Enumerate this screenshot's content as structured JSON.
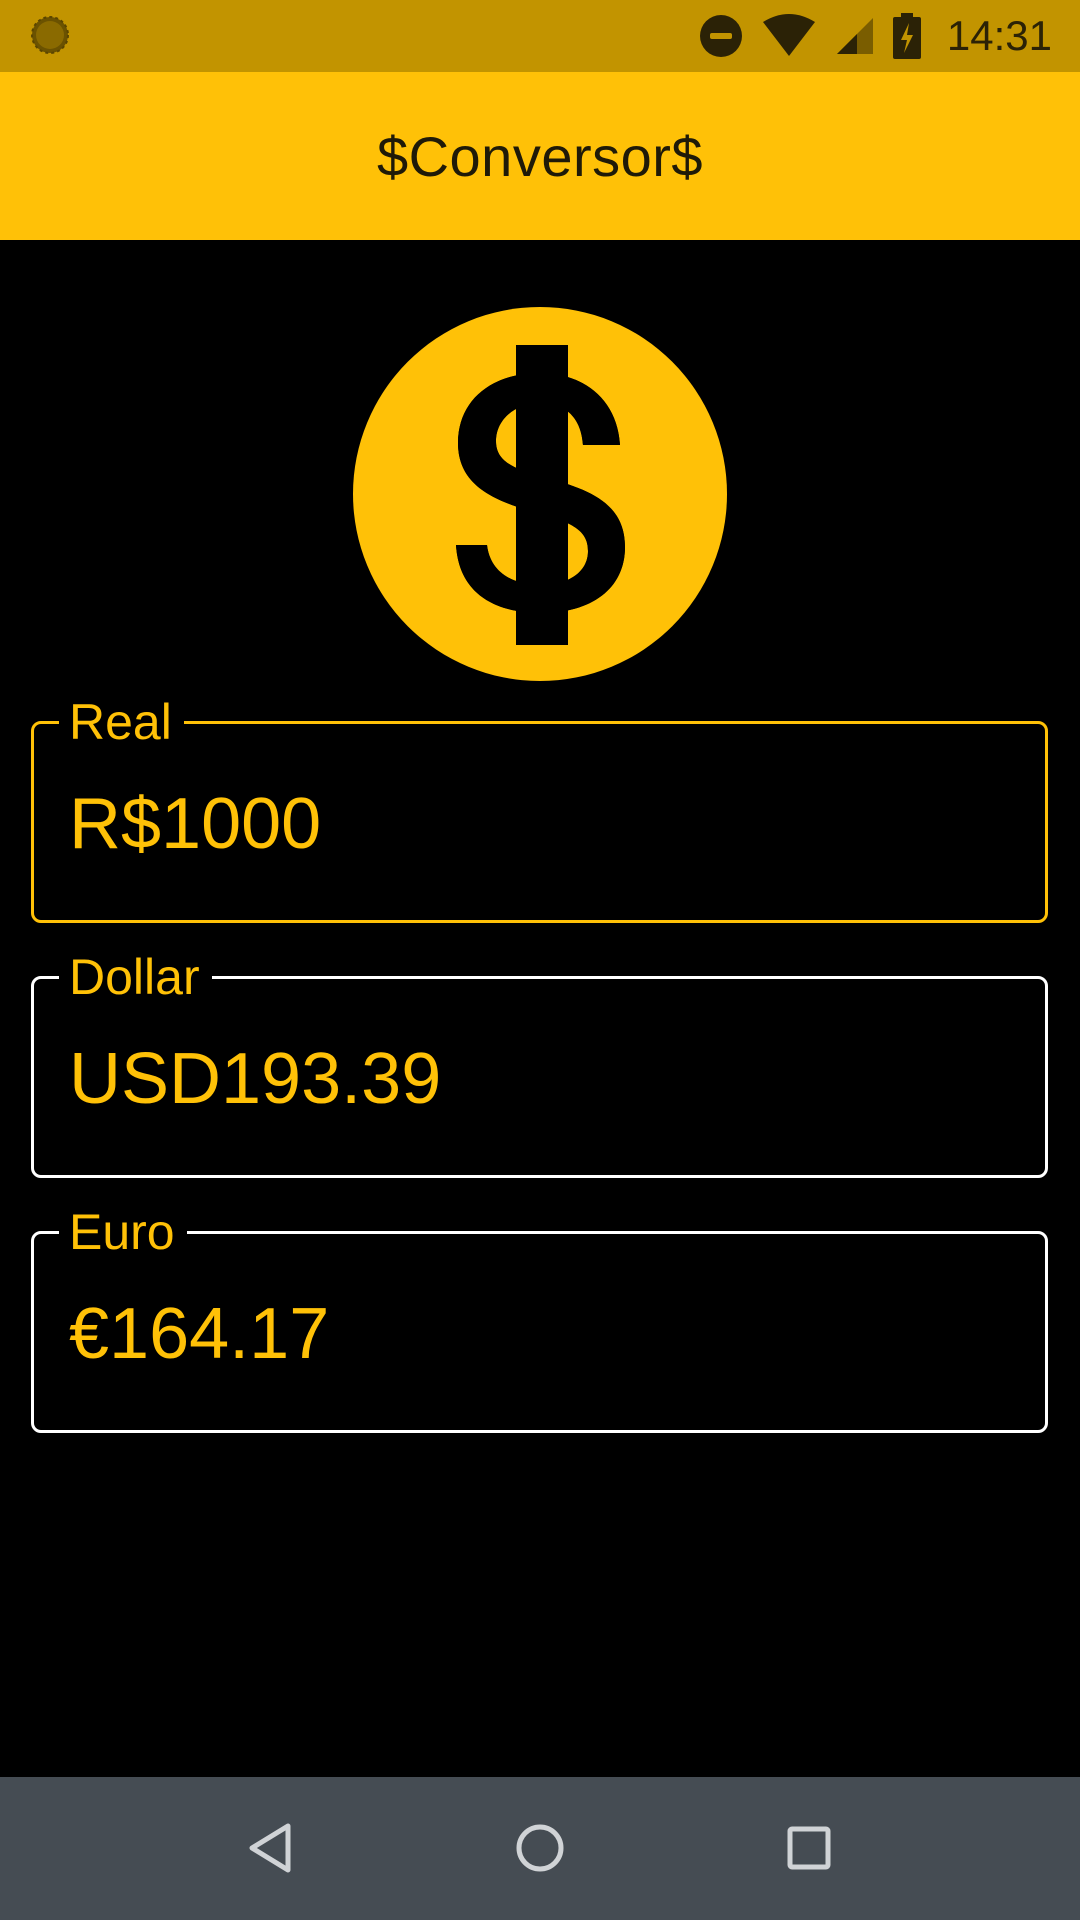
{
  "status_bar": {
    "time": "14:31",
    "icons": [
      "notification-circle-icon",
      "dnd-icon",
      "wifi-icon",
      "cell-signal-icon",
      "battery-charging-icon"
    ]
  },
  "app_bar": {
    "title": "$Conversor$"
  },
  "logo": {
    "icon": "dollar-coin-icon"
  },
  "fields": [
    {
      "label": "Real",
      "value": "R$1000",
      "focused": true
    },
    {
      "label": "Dollar",
      "value": "USD193.39",
      "focused": false
    },
    {
      "label": "Euro",
      "value": "€164.17",
      "focused": false
    }
  ],
  "nav_bar": {
    "buttons": [
      "back-icon",
      "home-icon",
      "recents-icon"
    ]
  },
  "colors": {
    "accent": "#FFC107",
    "status_bar": "#C29400",
    "background": "#000000",
    "nav_bar": "#454c53",
    "outline": "#ffffff"
  }
}
